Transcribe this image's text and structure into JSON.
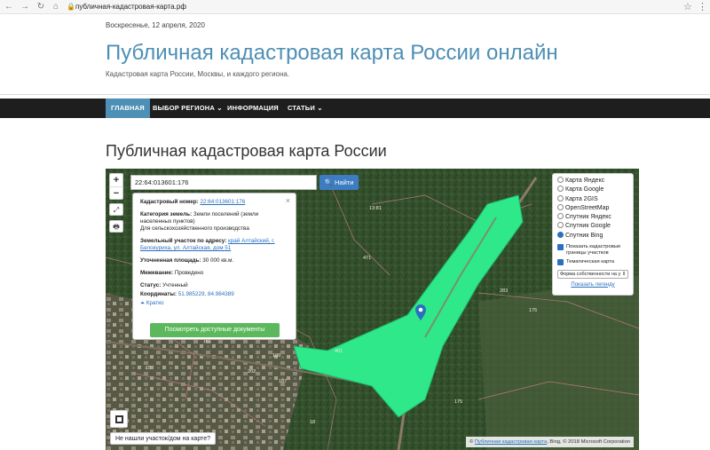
{
  "browser": {
    "url": "публичная-кадастровая-карта.рф",
    "lock_glyph": "🔒",
    "back_glyph": "←",
    "forward_glyph": "→",
    "reload_glyph": "↻",
    "home_glyph": "⌂",
    "star_glyph": "☆",
    "menu_glyph": "⋮"
  },
  "header": {
    "date": "Воскресенье, 12 апреля, 2020",
    "site_title": "Публичная кадастровая карта России онлайн",
    "tagline": "Кадастровая карта России, Москвы, и каждого региона."
  },
  "nav": {
    "items": [
      {
        "label": "ГЛАВНАЯ"
      },
      {
        "label": "ВЫБОР РЕГИОНА ⌄"
      },
      {
        "label": "ИНФОРМАЦИЯ"
      },
      {
        "label": "СТАТЬИ ⌄"
      }
    ]
  },
  "page": {
    "title": "Публичная кадастровая карта России"
  },
  "map": {
    "zoom_in": "+",
    "zoom_out": "−",
    "expand_glyph": "⤢",
    "print_glyph": "🖶",
    "search_value": "22:64:013601:176",
    "search_button": "🔍 Найти",
    "popup": {
      "close": "×",
      "cadastral_label": "Кадастровый номер:",
      "cadastral_value": "22:64:013601:176",
      "category_label": "Категория земель:",
      "category_value": "Земли поселений (земли населенных пунктов)",
      "usage_value": "Для сельскохозяйственного производства",
      "address_label": "Земельный участок по адресу:",
      "address_value": "край Алтайский, г. Белокуриха, ул. Алтайская, дом 51",
      "area_label": "Уточненная площадь:",
      "area_value": "30 000 кв.м.",
      "survey_label": "Межевание:",
      "survey_value": "Проведено",
      "status_label": "Статус:",
      "status_value": "Учтенный",
      "coords_label": "Координаты:",
      "coords_value": "51.985229, 84.984389",
      "less_link": "⏶ Кратко",
      "docs_button": "Посмотреть доступные документы"
    },
    "layers": {
      "options": [
        {
          "label": "Карта Яндекс",
          "selected": false
        },
        {
          "label": "Карта Google",
          "selected": false
        },
        {
          "label": "Карта 2GIS",
          "selected": false
        },
        {
          "label": "OpenStreetMap",
          "selected": false
        },
        {
          "label": "Спутник Яндекс",
          "selected": false
        },
        {
          "label": "Спутник Google",
          "selected": false
        },
        {
          "label": "Спутник Bing",
          "selected": true
        }
      ],
      "check_borders": "Показать кадастровые границы участков",
      "check_thematic": "Тематическая карта",
      "select_value": "Форма собственности на у ⇕",
      "legend_link": "Показать легенду"
    },
    "not_found": "Не нашли участок/дом на карте?",
    "attribution_prefix": "© ",
    "attribution_link": "Публичная кадастровая карта",
    "attribution_suffix": ", Bing, © 2018 Microsoft Corporation",
    "labels": [
      "13:81",
      "471",
      "283",
      "175",
      "401",
      "161",
      "175",
      "202",
      "187",
      "199",
      "15",
      "18"
    ]
  },
  "colors": {
    "accent": "#4d8fb5",
    "nav_bg": "#1e1e1e",
    "parcel": "#2ee88a",
    "button_green": "#5cb85c",
    "search_blue": "#3d7cc2"
  }
}
